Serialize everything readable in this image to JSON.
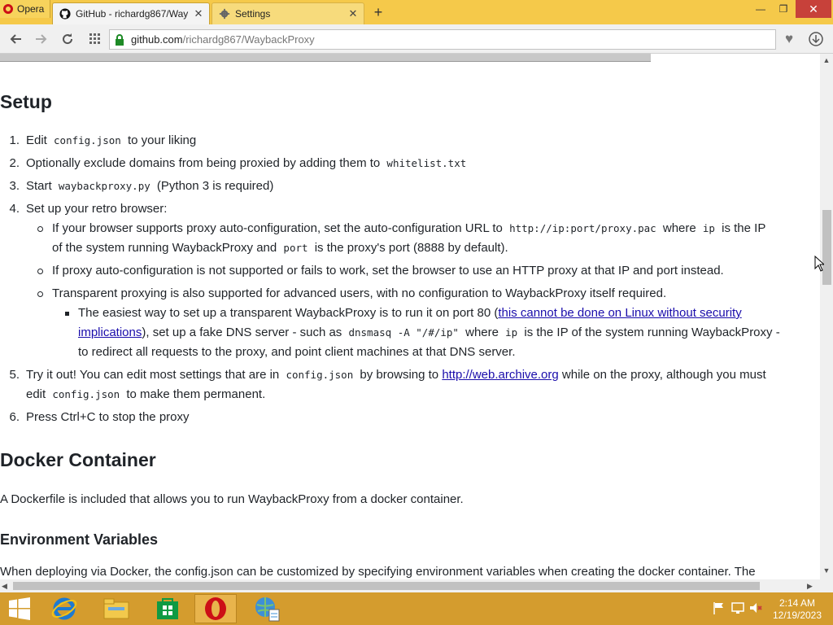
{
  "browser": {
    "menu_label": "Opera",
    "tabs": [
      {
        "title": "GitHub - richardg867/Way",
        "close": "✕"
      },
      {
        "title": "Settings",
        "close": "✕"
      }
    ],
    "new_tab": "+",
    "window_controls": {
      "minimize": "—",
      "maximize": "❐",
      "close": "✕"
    },
    "address": {
      "host": "github.com",
      "path": "/richardg867/WaybackProxy"
    },
    "nav_icons": [
      "back-icon",
      "forward-icon",
      "reload-icon",
      "speed-dial-icon",
      "bookmark-heart-icon",
      "download-icon"
    ]
  },
  "page": {
    "setup_heading": "Setup",
    "steps": {
      "n1": "1.",
      "s1_a": "Edit",
      "s1_code": "config.json",
      "s1_b": "to your liking",
      "n2": "2.",
      "s2_a": "Optionally exclude domains from being proxied by adding them to",
      "s2_code": "whitelist.txt",
      "n3": "3.",
      "s3_a": "Start",
      "s3_code": "waybackproxy.py",
      "s3_b": "(Python 3 is required)",
      "n4": "4.",
      "s4": "Set up your retro browser:",
      "b1_a": "If your browser supports proxy auto-configuration, set the auto-configuration URL to",
      "b1_code1": "http://ip:port/proxy.pac",
      "b1_b": "where",
      "b1_code2": "ip",
      "b1_c": "is the IP",
      "b1_d": "of the system running WaybackProxy and",
      "b1_code3": "port",
      "b1_e": "is the proxy's port (8888 by default).",
      "b2": "If proxy auto-configuration is not supported or fails to work, set the browser to use an HTTP proxy at that IP and port instead.",
      "b3": "Transparent proxying is also supported for advanced users, with no configuration to WaybackProxy itself required.",
      "sq_a": "The easiest way to set up a transparent WaybackProxy is to run it on port 80 (",
      "sq_link1": "this cannot be done on Linux without security",
      "sq_link2": "implications",
      "sq_b": "), set up a fake DNS server - such as",
      "sq_code1": "dnsmasq -A \"/#/ip\"",
      "sq_c": "where",
      "sq_code2": "ip",
      "sq_d": "is the IP of the system running WaybackProxy -",
      "sq_e": "to redirect all requests to the proxy, and point client machines at that DNS server.",
      "n5": "5.",
      "s5_a": "Try it out! You can edit most settings that are in",
      "s5_code1": "config.json",
      "s5_b": "by browsing to",
      "s5_link": "http://web.archive.org",
      "s5_c": "while on the proxy, although you must",
      "s5_d": "edit",
      "s5_code2": "config.json",
      "s5_e": "to make them permanent.",
      "n6": "6.",
      "s6": "Press Ctrl+C to stop the proxy"
    },
    "docker_heading": "Docker Container",
    "docker_text": "A Dockerfile is included that allows you to run WaybackProxy from a docker container.",
    "env_heading": "Environment Variables",
    "env_text": "When deploying via Docker, the config.json can be customized by specifying environment variables when creating the docker container. The"
  },
  "taskbar": {
    "apps": [
      "windows-start-icon",
      "internet-explorer-icon",
      "file-explorer-icon",
      "store-icon",
      "opera-icon",
      "network-settings-icon"
    ],
    "clock_time": "2:14 AM",
    "clock_date": "12/19/2023"
  },
  "colors": {
    "tabbar": "#f5c94a",
    "taskbar": "#d49c2e",
    "link": "#1a0dab",
    "opera_red": "#cc0f16"
  }
}
